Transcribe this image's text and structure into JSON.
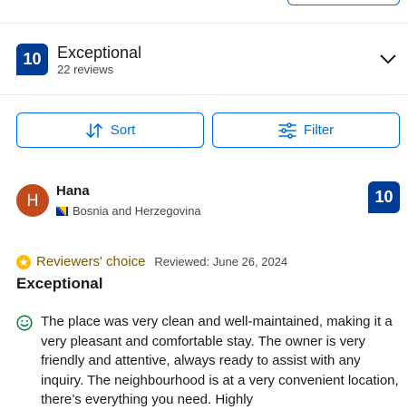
{
  "summary": {
    "score": "10",
    "title": "Exceptional",
    "count": "22 reviews"
  },
  "controls": {
    "sort_label": "Sort",
    "filter_label": "Filter"
  },
  "review": {
    "avatar_initial": "H",
    "name": "Hana",
    "country": "Bosnia and Herzegovina",
    "score": "10",
    "badge": "Reviewers' choice",
    "date": "Reviewed: June 26, 2024",
    "title": "Exceptional",
    "text": "The place was very clean and well-maintained, making it a very pleasant and comfortable stay. The owner is very friendly and attentive, always ready to assist with any inquiry. The neighbourhood is at a very convenient location, there’s everything you need. Highly"
  },
  "colors": {
    "brand_blue": "#003b95",
    "link_blue": "#006ce4",
    "avatar": "#c34a1c",
    "badge_gold": "#febb02",
    "smile_green": "#008234"
  },
  "icons": [
    "chevron-down-icon",
    "sort-icon",
    "filter-icon",
    "flag-icon",
    "star-badge-icon",
    "smile-icon"
  ]
}
